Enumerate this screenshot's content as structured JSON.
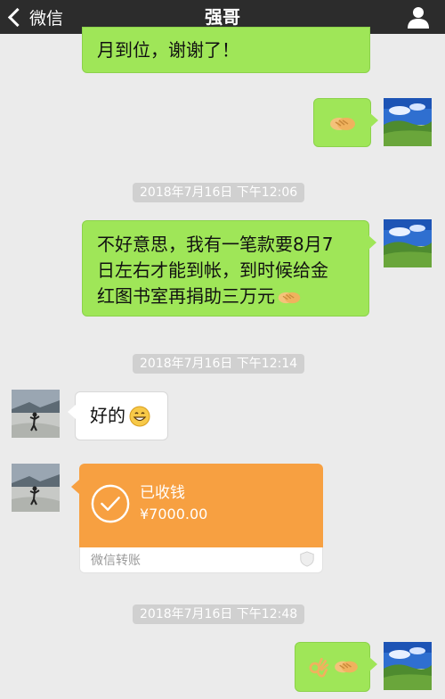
{
  "nav": {
    "back_label": "微信",
    "title": "强哥",
    "back_icon": "chevron-left-icon",
    "profile_icon": "person-icon"
  },
  "messages": {
    "m1": {
      "text": "月到位，谢谢了！"
    },
    "m2": {
      "emoji": "handshake"
    },
    "t1": {
      "text": "2018年7月16日  下午12:06"
    },
    "m3": {
      "line1": "不好意思，我有一笔款要8月7",
      "line2": "日左右才能到帐，到时候给金",
      "line3": "红图书室再捐助三万元",
      "emoji": "handshake"
    },
    "t2": {
      "text": "2018年7月16日  下午12:14"
    },
    "m4": {
      "text": "好的",
      "emoji": "grinning-face"
    },
    "m5": {
      "status": "已收钱",
      "amount": "¥7000.00",
      "source": "微信转账"
    },
    "t3": {
      "text": "2018年7月16日  下午12:48"
    },
    "m6": {
      "emoji1": "ok-hand",
      "emoji2": "handshake"
    }
  },
  "colors": {
    "navbar": "#2c2c2c",
    "background": "#ebebeb",
    "sent_bubble": "#9fe658",
    "received_bubble": "#ffffff",
    "transfer": "#f7a041"
  }
}
